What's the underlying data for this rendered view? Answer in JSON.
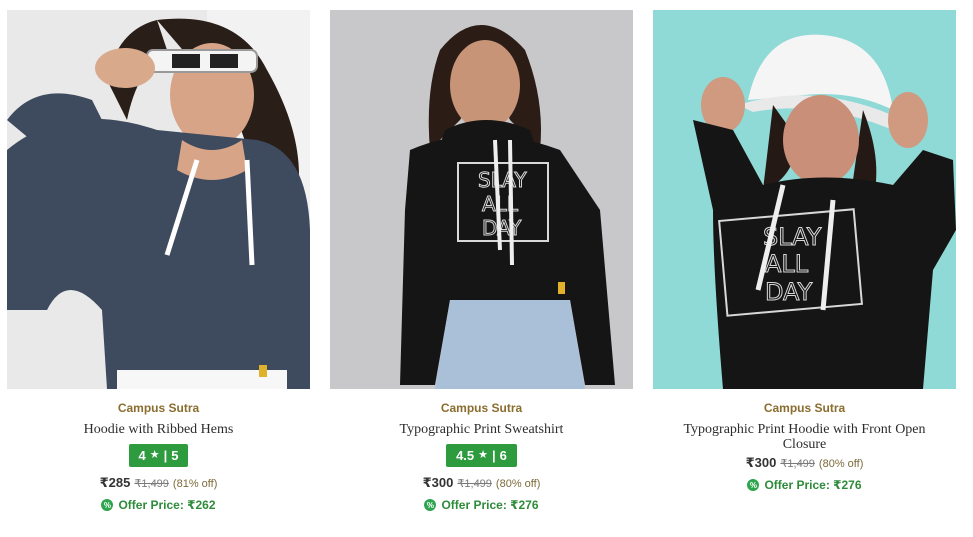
{
  "products": [
    {
      "brand": "Campus Sutra",
      "title": "Hoodie with Ribbed Hems",
      "rating": "4",
      "rating_count": "5",
      "price": "₹285",
      "mrp": "₹1,499",
      "discount": "(81% off)",
      "offer_label": "Offer Price: ₹262",
      "image": "woman in navy hoodie with white sunglasses"
    },
    {
      "brand": "Campus Sutra",
      "title": "Typographic Print Sweatshirt",
      "rating": "4.5",
      "rating_count": "6",
      "price": "₹300",
      "mrp": "₹1,499",
      "discount": "(80% off)",
      "offer_label": "Offer Price: ₹276",
      "image": "woman in black cropped hoodie with SLAY ALL DAY print",
      "print_text": [
        "SLAY",
        "ALL",
        "DAY"
      ]
    },
    {
      "brand": "Campus Sutra",
      "title": "Typographic Print Hoodie with Front Open Closure",
      "price": "₹300",
      "mrp": "₹1,499",
      "discount": "(80% off)",
      "offer_label": "Offer Price: ₹276",
      "image": "woman in black hoodie and white bucket hat with SLAY ALL DAY print",
      "print_text": [
        "SLAY",
        "ALL",
        "DAY"
      ]
    }
  ],
  "rating_star_icon": "star-icon",
  "offer_icon": "offer-badge-icon",
  "colors": {
    "brand": "#8a6d2f",
    "rating_badge": "#2e9b3e",
    "offer_text": "#2e8b3a"
  }
}
